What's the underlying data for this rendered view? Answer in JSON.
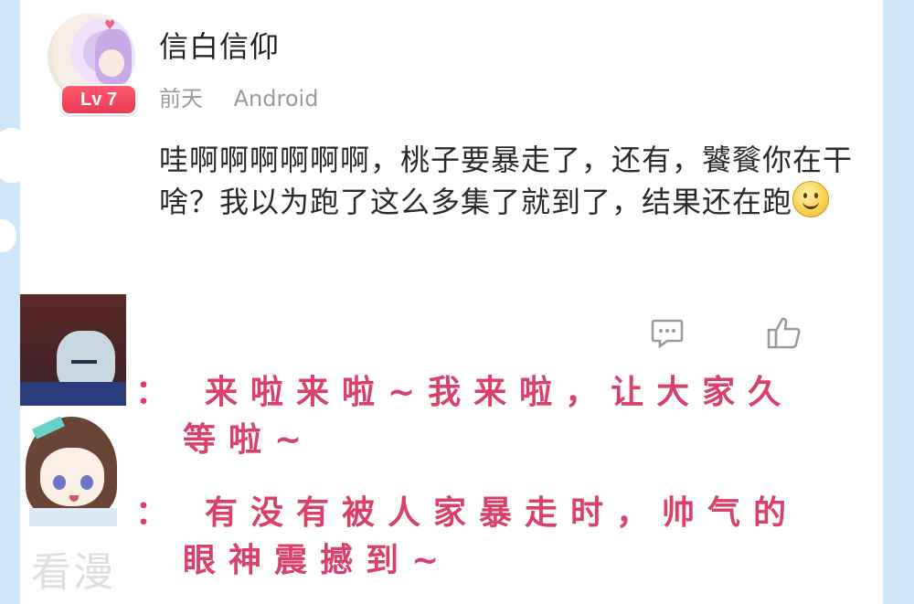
{
  "post": {
    "username": "信白信仰",
    "level": "Lv 7",
    "time": "前天",
    "device": "Android",
    "comment": "哇啊啊啊啊啊啊，桃子要暴走了，还有，饕餮你在干啥？我以为跑了这么多集了就到了，结果还在跑"
  },
  "dialogs": [
    {
      "colon": "：",
      "line1": "来啦来啦~我来啦，让大家久",
      "line2": "等啦~"
    },
    {
      "colon": "：",
      "line1": "有没有被人家暴走时，帅气的",
      "line2": "眼神震撼到~"
    }
  ],
  "watermark": "看漫",
  "icons": {
    "reply": "comment-icon",
    "like": "thumbs-up-icon",
    "emoji": "smile-emoji-icon"
  },
  "colors": {
    "dialog_text": "#d9416b",
    "badge": "#ff5a6e",
    "background": "#cfe6fb"
  }
}
